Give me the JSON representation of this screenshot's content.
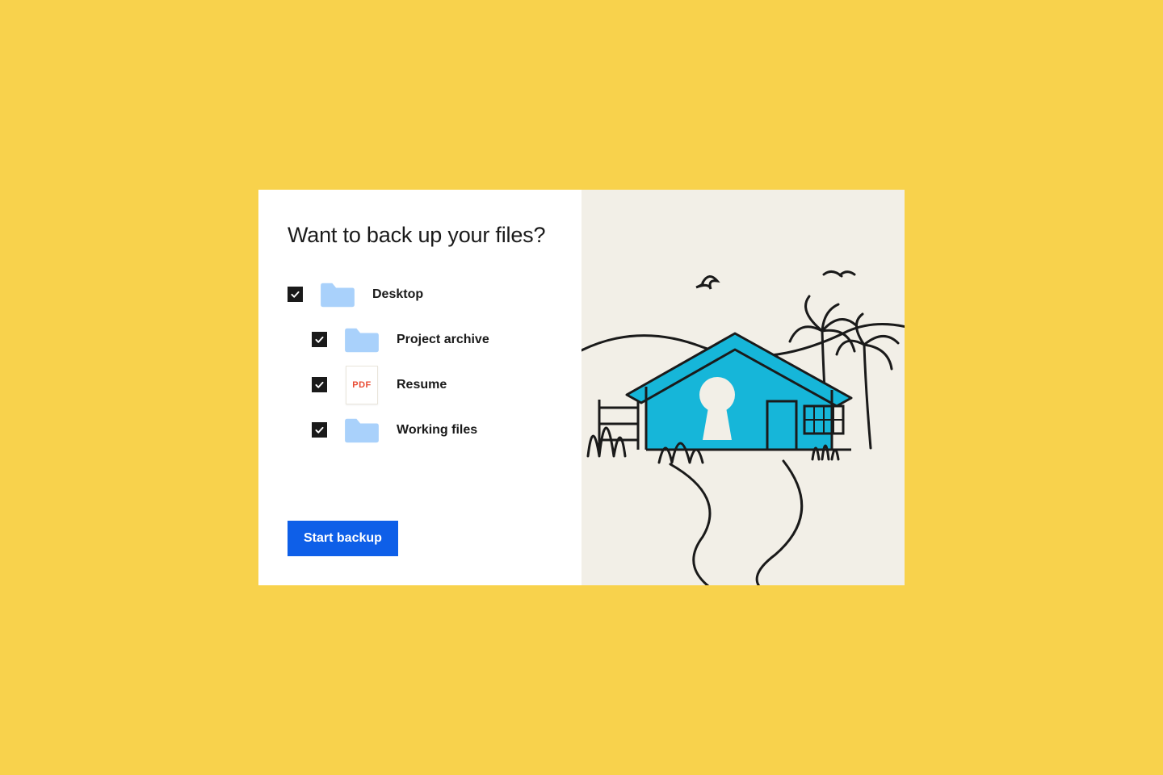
{
  "colors": {
    "page_bg": "#f8d24c",
    "card_bg": "#ffffff",
    "illustration_bg": "#f2efe7",
    "checkbox_bg": "#1a1a1a",
    "folder_fill": "#a9d1fb",
    "pdf_text": "#e84b33",
    "button_bg": "#0e5fe8",
    "house_fill": "#16b6d9",
    "stroke": "#1a1a1a"
  },
  "title": "Want to back up your files?",
  "items": [
    {
      "label": "Desktop",
      "icon": "folder",
      "checked": true,
      "depth": 0
    },
    {
      "label": "Project archive",
      "icon": "folder",
      "checked": true,
      "depth": 1
    },
    {
      "label": "Resume",
      "icon": "pdf",
      "checked": true,
      "depth": 1
    },
    {
      "label": "Working files",
      "icon": "folder",
      "checked": true,
      "depth": 1
    }
  ],
  "pdf_badge_text": "PDF",
  "button_label": "Start backup"
}
